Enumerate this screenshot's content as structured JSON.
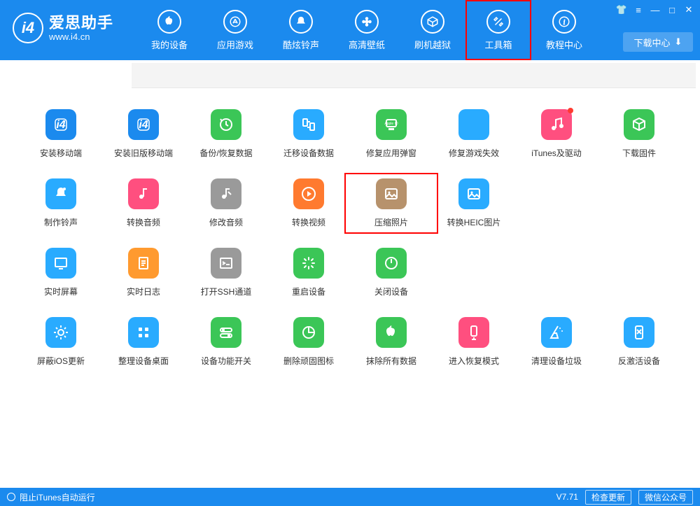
{
  "app": {
    "name": "爱思助手",
    "url": "www.i4.cn",
    "version": "V7.71"
  },
  "nav": {
    "items": [
      {
        "label": "我的设备",
        "icon": "apple"
      },
      {
        "label": "应用游戏",
        "icon": "appstore"
      },
      {
        "label": "酷炫铃声",
        "icon": "bell"
      },
      {
        "label": "高清壁纸",
        "icon": "flower"
      },
      {
        "label": "刷机越狱",
        "icon": "box"
      },
      {
        "label": "工具箱",
        "icon": "tools",
        "selected": true
      },
      {
        "label": "教程中心",
        "icon": "info"
      }
    ]
  },
  "download_center": "下载中心",
  "tools": [
    {
      "label": "安装移动端",
      "color": "#1b8aee",
      "icon": "i4"
    },
    {
      "label": "安装旧版移动端",
      "color": "#1b8aee",
      "icon": "i4"
    },
    {
      "label": "备份/恢复数据",
      "color": "#3bc657",
      "icon": "restore"
    },
    {
      "label": "迁移设备数据",
      "color": "#29abff",
      "icon": "transfer"
    },
    {
      "label": "修复应用弹窗",
      "color": "#3bc657",
      "icon": "appleid"
    },
    {
      "label": "修复游戏失效",
      "color": "#29abff",
      "icon": "appstore"
    },
    {
      "label": "iTunes及驱动",
      "color": "#ff4f7f",
      "icon": "music",
      "dot": true
    },
    {
      "label": "下载固件",
      "color": "#3bc657",
      "icon": "cube"
    },
    {
      "label": "制作铃声",
      "color": "#29abff",
      "icon": "bell2"
    },
    {
      "label": "转换音频",
      "color": "#ff4f7f",
      "icon": "audio"
    },
    {
      "label": "修改音频",
      "color": "#9a9a9a",
      "icon": "audio-edit"
    },
    {
      "label": "转换视频",
      "color": "#ff7a2f",
      "icon": "play"
    },
    {
      "label": "压缩照片",
      "color": "#b7926c",
      "icon": "image",
      "highlight": true
    },
    {
      "label": "转换HEIC图片",
      "color": "#29abff",
      "icon": "image"
    },
    {
      "label": "实时屏幕",
      "color": "#29abff",
      "icon": "monitor"
    },
    {
      "label": "实时日志",
      "color": "#ff9a2f",
      "icon": "doc"
    },
    {
      "label": "打开SSH通道",
      "color": "#9a9a9a",
      "icon": "terminal"
    },
    {
      "label": "重启设备",
      "color": "#3bc657",
      "icon": "loading"
    },
    {
      "label": "关闭设备",
      "color": "#3bc657",
      "icon": "power"
    },
    {
      "label": "屏蔽iOS更新",
      "color": "#29abff",
      "icon": "gear"
    },
    {
      "label": "整理设备桌面",
      "color": "#29abff",
      "icon": "grid"
    },
    {
      "label": "设备功能开关",
      "color": "#3bc657",
      "icon": "toggles"
    },
    {
      "label": "删除顽固图标",
      "color": "#3bc657",
      "icon": "pie"
    },
    {
      "label": "抹除所有数据",
      "color": "#3bc657",
      "icon": "apple"
    },
    {
      "label": "进入恢复模式",
      "color": "#ff4f7f",
      "icon": "phone-down"
    },
    {
      "label": "清理设备垃圾",
      "color": "#29abff",
      "icon": "broom"
    },
    {
      "label": "反激活设备",
      "color": "#29abff",
      "icon": "phone-off"
    }
  ],
  "footer": {
    "block_itunes": "阻止iTunes自动运行",
    "check_update": "检查更新",
    "wechat": "微信公众号"
  }
}
